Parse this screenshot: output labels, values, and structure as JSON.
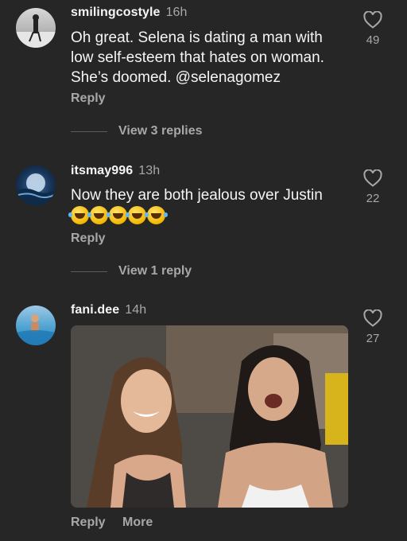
{
  "comments": [
    {
      "username": "smilingcostyle",
      "time": "16h",
      "text": "Oh great. Selena is dating a man with low self-esteem that hates on woman. She’s doomed. @selenagomez",
      "likes": "49",
      "reply_label": "Reply",
      "view_replies": "View 3 replies"
    },
    {
      "username": "itsmay996",
      "time": "13h",
      "text": "Now they are both jealous over Justin",
      "emojis": "🤣🤣🤣🤣🤣",
      "likes": "22",
      "reply_label": "Reply",
      "view_replies": "View 1 reply"
    },
    {
      "username": "fani.dee",
      "time": "14h",
      "likes": "27",
      "reply_label": "Reply",
      "more_label": "More"
    }
  ],
  "colors": {
    "background": "#262626",
    "primary_text": "#f5f5f5",
    "secondary_text": "#a8a8a8"
  }
}
